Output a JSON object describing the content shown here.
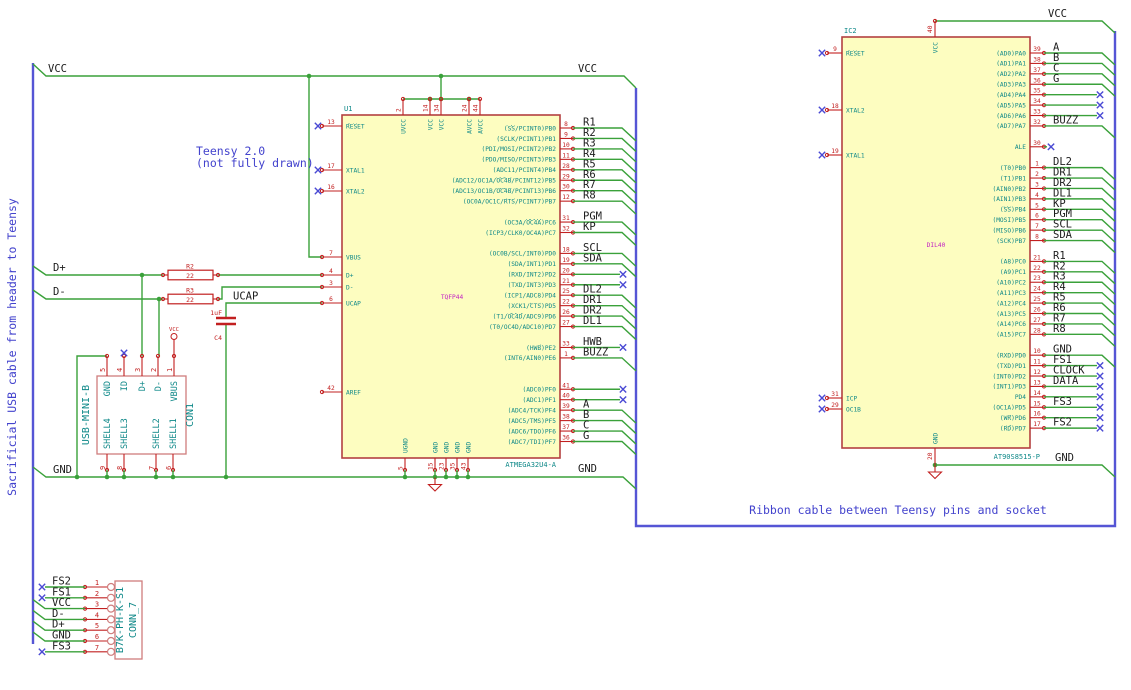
{
  "notes": {
    "sacrificial": "Sacrificial USB cable from header to Teensy",
    "teensy_line1": "Teensy 2.0",
    "teensy_line2": "(not fully drawn)",
    "ribbon": "Ribbon cable between Teensy pins and socket"
  },
  "colors": {
    "wire": "#3aa13a",
    "bus": "#5555d5",
    "note": "#4343cd",
    "nc": "#4a4ad4",
    "pin": "#c22020",
    "pin_name": "#0e8888",
    "ref": "#0e8888",
    "label": "#1c1c1c",
    "package": "#c322c3",
    "body_fill": "#fdfdc0",
    "body_stroke": "#b44040",
    "conn_stroke": "#cf7d7d"
  },
  "net_labels": {
    "vcc_left": "VCC",
    "vcc_right": "VCC",
    "dplus": "D+",
    "dminus": "D-",
    "ucap": "UCAP",
    "gnd_left": "GND",
    "gnd_right": "GND",
    "ic2_vcc": "VCC",
    "ic2_gnd": "GND"
  },
  "power": {
    "vcc_flag": "VCC"
  },
  "u1": {
    "ref": "U1",
    "value": "ATMEGA32U4-A",
    "package": "TQFP44",
    "left_pins": [
      {
        "num": "13",
        "name": "~RESET~",
        "nc": true
      },
      {
        "num": "17",
        "name": "XTAL1",
        "nc": true
      },
      {
        "num": "16",
        "name": "XTAL2",
        "nc": true
      },
      {
        "num": "7",
        "name": "VBUS"
      },
      {
        "num": "4",
        "name": "D+"
      },
      {
        "num": "3",
        "name": "D-"
      },
      {
        "num": "6",
        "name": "UCAP"
      },
      {
        "num": "42",
        "name": "AREF"
      }
    ],
    "right_pins": [
      {
        "num": "8",
        "name": "(~SS~/PCINT0)PB0",
        "label": "R1"
      },
      {
        "num": "9",
        "name": "(SCLK/PCINT1)PB1",
        "label": "R2"
      },
      {
        "num": "10",
        "name": "(PDI/MOSI/PCINT2)PB2",
        "label": "R3"
      },
      {
        "num": "11",
        "name": "(PDO/MISO/PCINT3)PB3",
        "label": "R4"
      },
      {
        "num": "28",
        "name": "(ADC11/PCINT4)PB4",
        "label": "R5"
      },
      {
        "num": "29",
        "name": "(ADC12/OC1A/~OC4B~/PCINT12)PB5",
        "label": "R6"
      },
      {
        "num": "30",
        "name": "(ADC13/OC1B/~OC4B~/PCINT13)PB6",
        "label": "R7"
      },
      {
        "num": "12",
        "name": "(OC0A/OC1C/~RTS~/PCINT7)PB7",
        "label": "R8"
      },
      {
        "num": "31",
        "name": "(OC3A/~OC4A~)PC6",
        "label": "PGM",
        "gap": 1
      },
      {
        "num": "32",
        "name": "(ICP3/CLK0/OC4A)PC7",
        "label": "KP"
      },
      {
        "num": "18",
        "name": "(OC0B/SCL/INT0)PD0",
        "label": "SCL",
        "gap": 1
      },
      {
        "num": "19",
        "name": "(SDA/INT1)PD1",
        "label": "SDA"
      },
      {
        "num": "20",
        "name": "(RXD/INT2)PD2",
        "nc": true
      },
      {
        "num": "21",
        "name": "(TXD/INT3)PD3",
        "nc": true
      },
      {
        "num": "25",
        "name": "(ICP1/ADC8)PD4",
        "label": "DL2"
      },
      {
        "num": "22",
        "name": "(XCK1/~CTS~)PD5",
        "label": "DR1"
      },
      {
        "num": "26",
        "name": "(T1/~OC4D~/ADC9)PD6",
        "label": "DR2"
      },
      {
        "num": "27",
        "name": "(T0/OC4D/ADC10)PD7",
        "label": "DL1"
      },
      {
        "num": "33",
        "name": "(~HWB~)PE2",
        "label": "HWB",
        "nc": true,
        "gap": 1
      },
      {
        "num": "1",
        "name": "(INT6/AIN0)PE6",
        "label": "BUZZ"
      },
      {
        "num": "41",
        "name": "(ADC0)PF0",
        "nc": true,
        "gap": 2
      },
      {
        "num": "40",
        "name": "(ADC1)PF1",
        "nc": true
      },
      {
        "num": "39",
        "name": "(ADC4/TCK)PF4",
        "label": "A"
      },
      {
        "num": "38",
        "name": "(ADC5/TMS)PF5",
        "label": "B"
      },
      {
        "num": "37",
        "name": "(ADC6/TDO)PF6",
        "label": "C"
      },
      {
        "num": "36",
        "name": "(ADC7/TDI)PF7",
        "label": "G"
      }
    ],
    "top_pins": [
      {
        "num": "2",
        "name": "UVCC"
      },
      {
        "num": "14",
        "name": "VCC"
      },
      {
        "num": "34",
        "name": "VCC"
      },
      {
        "num": "24",
        "name": "AVCC"
      },
      {
        "num": "44",
        "name": "AVCC"
      }
    ],
    "bottom_pins": [
      {
        "num": "5",
        "name": "UGND"
      },
      {
        "num": "15",
        "name": "GND"
      },
      {
        "num": "23",
        "name": "GND"
      },
      {
        "num": "35",
        "name": "GND"
      },
      {
        "num": "43",
        "name": "GND"
      }
    ]
  },
  "ic2": {
    "ref": "IC2",
    "value": "AT90S8515-P",
    "package": "DIL40",
    "top_pin": {
      "num": "40",
      "name": "VCC"
    },
    "bottom_pin": {
      "num": "20",
      "name": "GND"
    },
    "left_pins": [
      {
        "num": "9",
        "name": "~RESET~",
        "nc": true
      },
      {
        "num": "18",
        "name": "XTAL2",
        "nc": true
      },
      {
        "num": "19",
        "name": "XTAL1",
        "nc": true
      },
      {
        "num": "31",
        "name": "ICP",
        "nc": true
      },
      {
        "num": "29",
        "name": "OC1B",
        "nc": true
      }
    ],
    "right_pins": [
      {
        "num": "39",
        "name": "(AD0)PA0",
        "label": "A"
      },
      {
        "num": "38",
        "name": "(AD1)PA1",
        "label": "B"
      },
      {
        "num": "37",
        "name": "(AD2)PA2",
        "label": "C"
      },
      {
        "num": "36",
        "name": "(AD3)PA3",
        "label": "G"
      },
      {
        "num": "35",
        "name": "(AD4)PA4",
        "nc": true
      },
      {
        "num": "34",
        "name": "(AD5)PA5",
        "nc": true
      },
      {
        "num": "33",
        "name": "(AD6)PA6",
        "nc": true
      },
      {
        "num": "32",
        "name": "(AD7)PA7",
        "label": "BUZZ"
      },
      {
        "num": "30",
        "name": "ALE",
        "nc": true,
        "nc_short": true,
        "gap": 1
      },
      {
        "num": "1",
        "name": "(T0)PB0",
        "label": "DL2",
        "gap": 1
      },
      {
        "num": "2",
        "name": "(T1)PB1",
        "label": "DR1"
      },
      {
        "num": "3",
        "name": "(AIN0)PB2",
        "label": "DR2"
      },
      {
        "num": "4",
        "name": "(AIN1)PB3",
        "label": "DL1"
      },
      {
        "num": "5",
        "name": "(~SS~)PB4",
        "label": "KP"
      },
      {
        "num": "6",
        "name": "(MOSI)PB5",
        "label": "PGM"
      },
      {
        "num": "7",
        "name": "(MISO)PB6",
        "label": "SCL"
      },
      {
        "num": "8",
        "name": "(SCK)PB7",
        "label": "SDA"
      },
      {
        "num": "21",
        "name": "(A8)PC0",
        "label": "R1",
        "gap": 1
      },
      {
        "num": "22",
        "name": "(A9)PC1",
        "label": "R2"
      },
      {
        "num": "23",
        "name": "(A10)PC2",
        "label": "R3"
      },
      {
        "num": "24",
        "name": "(A11)PC3",
        "label": "R4"
      },
      {
        "num": "25",
        "name": "(A12)PC4",
        "label": "R5"
      },
      {
        "num": "26",
        "name": "(A13)PC5",
        "label": "R6"
      },
      {
        "num": "27",
        "name": "(A14)PC6",
        "label": "R7"
      },
      {
        "num": "28",
        "name": "(A15)PC7",
        "label": "R8"
      },
      {
        "num": "10",
        "name": "(RXD)PD0",
        "label": "GND",
        "gap": 1
      },
      {
        "num": "11",
        "name": "(TXD)PD1",
        "label": "FS1",
        "nc": true
      },
      {
        "num": "12",
        "name": "(INT0)PD2",
        "label": "CLOCK",
        "nc": true
      },
      {
        "num": "13",
        "name": "(INT1)PD3",
        "label": "DATA",
        "nc": true
      },
      {
        "num": "14",
        "name": "PD4",
        "nc": true
      },
      {
        "num": "15",
        "name": "(OC1A)PD5",
        "label": "FS3",
        "nc": true
      },
      {
        "num": "16",
        "name": "(~WR~)PD6",
        "nc": true
      },
      {
        "num": "17",
        "name": "(~RD~)PD7",
        "label": "FS2",
        "nc": true
      }
    ]
  },
  "con1": {
    "ref": "CON1",
    "value": "USB-MINI-B",
    "top_pins": [
      {
        "num": "5",
        "name": "GND"
      },
      {
        "num": "4",
        "name": "ID",
        "nc": true
      },
      {
        "num": "3",
        "name": "D+"
      },
      {
        "num": "2",
        "name": "D-"
      },
      {
        "num": "1",
        "name": "VBUS",
        "power": true
      }
    ],
    "bottom_pins": [
      {
        "num": "9",
        "name": "SHELL4"
      },
      {
        "num": "8",
        "name": "SHELL3"
      },
      {
        "num": "7",
        "name": "SHELL2"
      },
      {
        "num": "6",
        "name": "SHELL1"
      }
    ]
  },
  "conn7": {
    "ref": "CONN_7",
    "value": "B7K-PH-K-S1",
    "pins": [
      {
        "num": "1",
        "label": "FS2",
        "nc": true
      },
      {
        "num": "2",
        "label": "FS1",
        "nc": true
      },
      {
        "num": "3",
        "label": "VCC",
        "bus": true
      },
      {
        "num": "4",
        "label": "D-",
        "bus": true
      },
      {
        "num": "5",
        "label": "D+",
        "bus": true
      },
      {
        "num": "6",
        "label": "GND",
        "bus": true
      },
      {
        "num": "7",
        "label": "FS3",
        "nc": true
      }
    ]
  },
  "r2": {
    "ref": "R2",
    "value": "22"
  },
  "r3": {
    "ref": "R3",
    "value": "22"
  },
  "c4": {
    "ref": "C4",
    "value": "1uF"
  }
}
